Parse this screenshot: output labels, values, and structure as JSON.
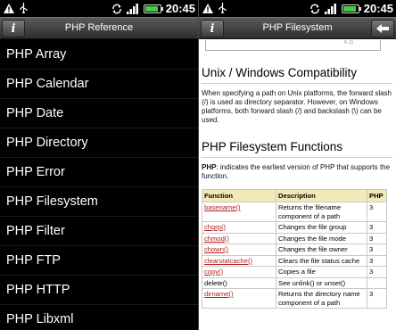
{
  "status": {
    "time": "20:45",
    "battery_level": 0.9,
    "icons": [
      "warning-icon",
      "usb-icon",
      "sync-icon",
      "signal-icon"
    ]
  },
  "left": {
    "title": "PHP Reference",
    "info_label": "i",
    "items": [
      "PHP Array",
      "PHP Calendar",
      "PHP Date",
      "PHP Directory",
      "PHP Error",
      "PHP Filesystem",
      "PHP Filter",
      "PHP FTP",
      "PHP HTTP",
      "PHP Libxml"
    ]
  },
  "right": {
    "title": "PHP Filesystem",
    "info_label": "i",
    "top_cell": "4.3)",
    "compat_title": "Unix / Windows Compatibility",
    "compat_text": "When specifying a path on Unix platforms, the forward slash (/) is used as directory separator. However, on Windows platforms, both forward slash (/) and backslash (\\) can be used.",
    "functions_title": "PHP Filesystem Functions",
    "php_note_label": "PHP",
    "php_note_text": ": indicates the earliest version of PHP that supports the function.",
    "table": {
      "headers": [
        "Function",
        "Description",
        "PHP"
      ],
      "rows": [
        {
          "fn": "basename()",
          "link": true,
          "desc": "Returns the filename component of a path",
          "ver": "3"
        },
        {
          "fn": "chgrp()",
          "link": true,
          "desc": "Changes the file group",
          "ver": "3"
        },
        {
          "fn": "chmod()",
          "link": true,
          "desc": "Changes the file mode",
          "ver": "3"
        },
        {
          "fn": "chown()",
          "link": true,
          "desc": "Changes the file owner",
          "ver": "3"
        },
        {
          "fn": "clearstatcache()",
          "link": true,
          "desc": "Clears the file status cache",
          "ver": "3"
        },
        {
          "fn": "copy()",
          "link": true,
          "desc": "Copies a file",
          "ver": "3"
        },
        {
          "fn": "delete()",
          "link": false,
          "desc": "See unlink() or unset()",
          "ver": ""
        },
        {
          "fn": "dirname()",
          "link": true,
          "desc": "Returns the directory name component of a path",
          "ver": "3"
        }
      ]
    }
  }
}
